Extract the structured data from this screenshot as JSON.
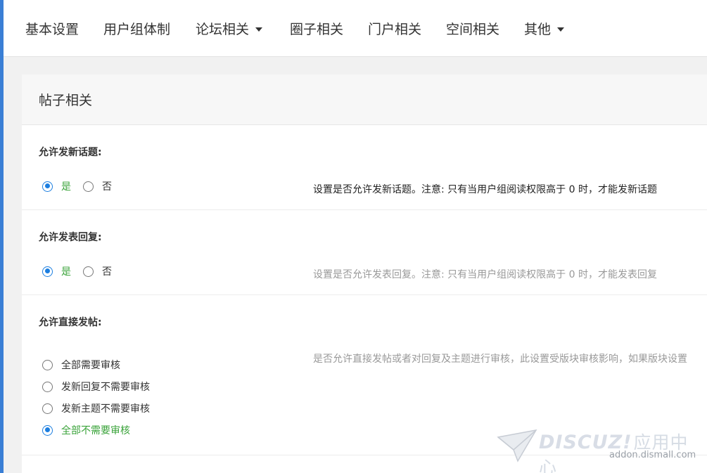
{
  "nav": {
    "items": [
      {
        "label": "基本设置"
      },
      {
        "label": "用户组体制"
      },
      {
        "label": "论坛相关"
      },
      {
        "label": "圈子相关"
      },
      {
        "label": "门户相关"
      },
      {
        "label": "空间相关"
      },
      {
        "label": "其他"
      }
    ]
  },
  "panel": {
    "title": "帖子相关",
    "settings": [
      {
        "title": "允许发新话题:",
        "options": [
          {
            "label": "是",
            "checked": true
          },
          {
            "label": "否",
            "checked": false
          }
        ],
        "description": "设置是否允许发新话题。注意: 只有当用户组阅读权限高于 0 时，才能发新话题"
      },
      {
        "title": "允许发表回复:",
        "options": [
          {
            "label": "是",
            "checked": true
          },
          {
            "label": "否",
            "checked": false
          }
        ],
        "description": "设置是否允许发表回复。注意: 只有当用户组阅读权限高于 0 时，才能发表回复"
      },
      {
        "title": "允许直接发帖:",
        "options": [
          {
            "label": "全部需要审核",
            "checked": false
          },
          {
            "label": "发新回复不需要审核",
            "checked": false
          },
          {
            "label": "发新主题不需要审核",
            "checked": false
          },
          {
            "label": "全部不需要审核",
            "checked": true
          }
        ],
        "description": "是否允许直接发帖或者对回复及主题进行审核，此设置受版块审核影响，如果版块设置"
      }
    ]
  },
  "watermark": {
    "brand": "DISCUZ!",
    "brand_cn": "应用中心",
    "url": "addon.dismall.com"
  },
  "colors": {
    "accent": "#1b7ee0",
    "checked_label": "#3aa33a",
    "left_bar": "#3a7fd5"
  }
}
